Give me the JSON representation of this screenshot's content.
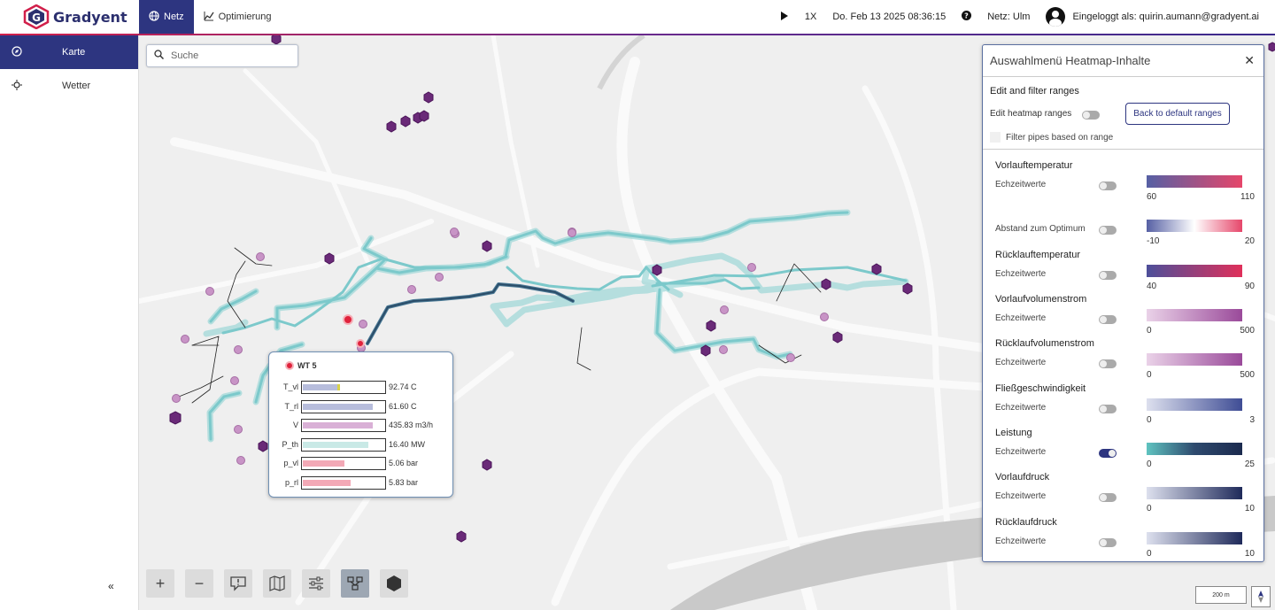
{
  "app": {
    "brand": "Gradyent",
    "nav": [
      {
        "label": "Netz",
        "active": true
      },
      {
        "label": "Optimierung",
        "active": false
      }
    ],
    "speed": "1X",
    "datetime": "Do. Feb 13 2025 08:36:15",
    "network": "Netz: Ulm",
    "user": "Eingeloggt als: quirin.aumann@gradyent.ai"
  },
  "sidebar": {
    "items": [
      {
        "label": "Karte",
        "active": true
      },
      {
        "label": "Wetter",
        "active": false
      }
    ]
  },
  "search": {
    "placeholder": "Suche"
  },
  "popup": {
    "title": "WT 5",
    "rows": [
      {
        "label": "T_vl",
        "value": "92.74 C",
        "fill": 0.45,
        "color": "#b7bddc"
      },
      {
        "label": "T_rl",
        "value": "61.60 C",
        "fill": 0.86,
        "color": "#b7bddc"
      },
      {
        "label": "V",
        "value": "435.83 m3/h",
        "fill": 0.86,
        "color": "#d9b0d6"
      },
      {
        "label": "P_th",
        "value": "16.40 MW",
        "fill": 0.8,
        "color": "#c9e9e6"
      },
      {
        "label": "p_vl",
        "value": "5.06 bar",
        "fill": 0.51,
        "color": "#f3a9b6"
      },
      {
        "label": "p_rl",
        "value": "5.83 bar",
        "fill": 0.59,
        "color": "#f3a9b6"
      }
    ]
  },
  "scale": "200 m",
  "panel": {
    "title": "Auswahlmenü Heatmap-Inhalte",
    "section_title": "Edit and filter ranges",
    "edit_label": "Edit heatmap ranges",
    "reset_button": "Back to default ranges",
    "filter_label": "Filter pipes based on range",
    "metrics": [
      {
        "title": "Vorlauftemperatur",
        "label": "Echzeitwerte",
        "on": false,
        "min": "60",
        "max": "110",
        "grad": [
          "#5660a4",
          "#e6466a"
        ]
      },
      {
        "title": "",
        "label": "Abstand zum Optimum",
        "on": false,
        "min": "-10",
        "max": "20",
        "grad": [
          "#5660a4",
          "#ffffff",
          "#e6466a"
        ]
      },
      {
        "title": "Rücklauftemperatur",
        "label": "Echzeitwerte",
        "on": false,
        "min": "40",
        "max": "90",
        "grad": [
          "#4d4f9a",
          "#e0305a"
        ]
      },
      {
        "title": "Vorlaufvolumenstrom",
        "label": "Echzeitwerte",
        "on": false,
        "min": "0",
        "max": "500",
        "grad": [
          "#ead2e8",
          "#9a4a9a"
        ]
      },
      {
        "title": "Rücklaufvolumenstrom",
        "label": "Echzeitwerte",
        "on": false,
        "min": "0",
        "max": "500",
        "grad": [
          "#ead2e8",
          "#9a4a9a"
        ]
      },
      {
        "title": "Fließgeschwindigkeit",
        "label": "Echzeitwerte",
        "on": false,
        "min": "0",
        "max": "3",
        "grad": [
          "#dde0ee",
          "#3f4d95"
        ]
      },
      {
        "title": "Leistung",
        "label": "Echzeitwerte",
        "on": true,
        "min": "0",
        "max": "25",
        "grad": [
          "#5fc3c0",
          "#2e4a6e",
          "#1b2a4e"
        ]
      },
      {
        "title": "Vorlaufdruck",
        "label": "Echzeitwerte",
        "on": false,
        "min": "0",
        "max": "10",
        "grad": [
          "#dde0ee",
          "#1f2a5a"
        ]
      },
      {
        "title": "Rücklaufdruck",
        "label": "Echzeitwerte",
        "on": false,
        "min": "0",
        "max": "10",
        "grad": [
          "#dde0ee",
          "#1f2a5a"
        ]
      }
    ]
  }
}
